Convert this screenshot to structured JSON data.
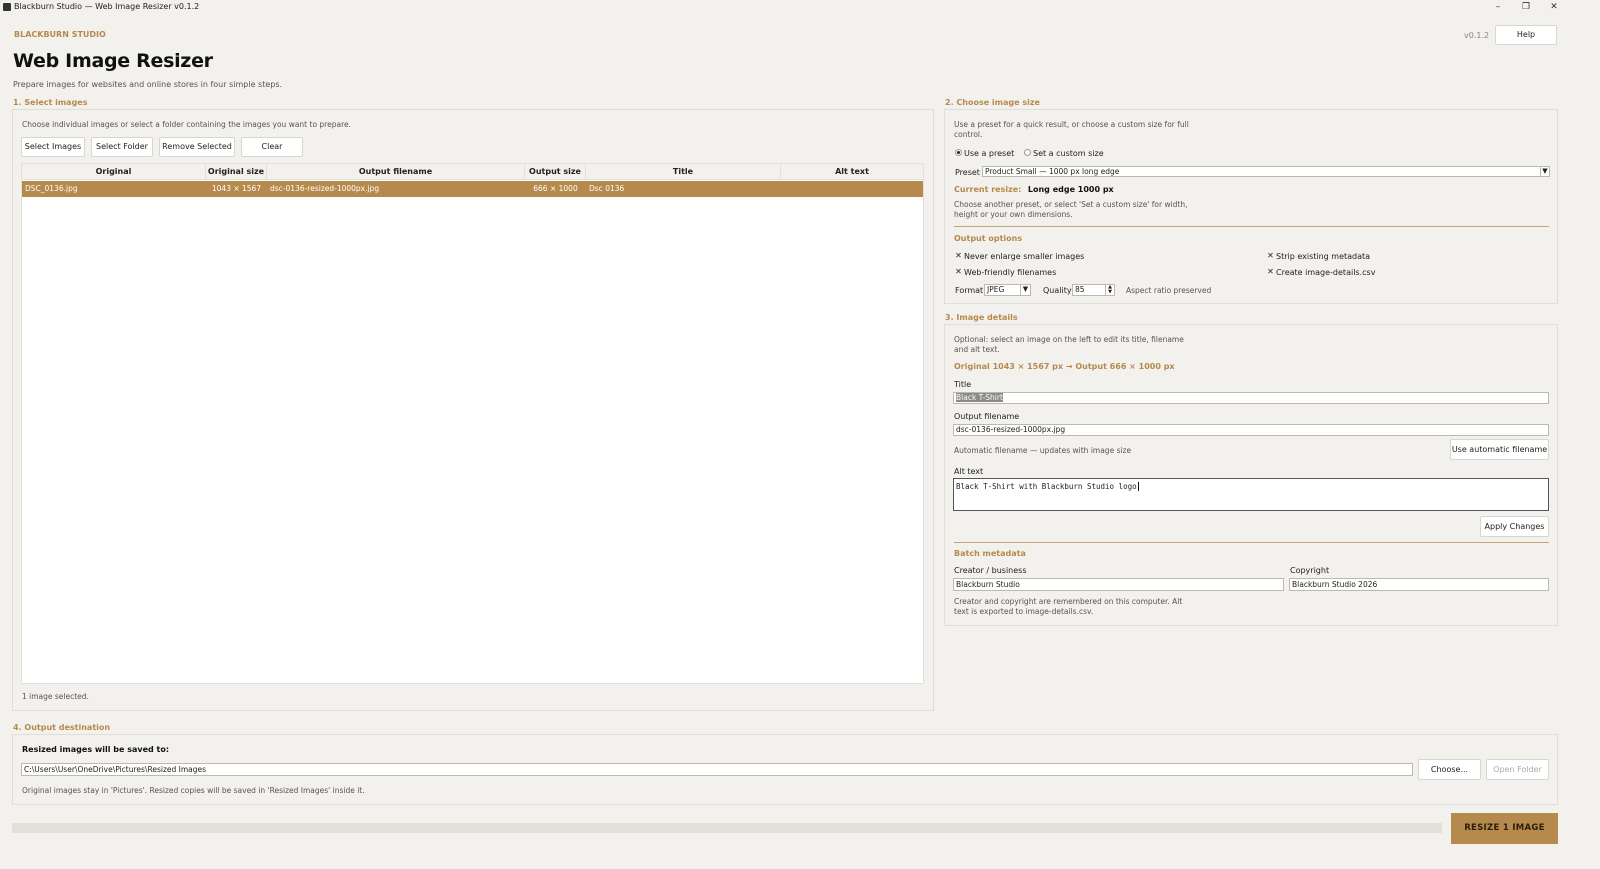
{
  "window": {
    "title": "Blackburn Studio — Web Image Resizer v0.1.2",
    "min_glyph": "–",
    "max_glyph": "❐",
    "close_glyph": "✕"
  },
  "header": {
    "brand": "BLACKBURN STUDIO",
    "version": "v0.1.2",
    "help_label": "Help",
    "title": "Web Image Resizer",
    "subtitle": "Prepare images for websites and online stores in four simple steps."
  },
  "select_images": {
    "section_label": "1. Select images",
    "hint": "Choose individual images or select a folder containing the images you want to prepare.",
    "buttons": {
      "select_images": "Select Images",
      "select_folder": "Select Folder",
      "remove_selected": "Remove Selected",
      "clear": "Clear"
    },
    "columns": [
      "Original",
      "Original size",
      "Output filename",
      "Output size",
      "Title",
      "Alt text"
    ],
    "rows": [
      {
        "original": "DSC_0136.jpg",
        "original_size": "1043 × 1567",
        "output_filename": "dsc-0136-resized-1000px.jpg",
        "output_size": "666 × 1000",
        "title": "Dsc 0136",
        "alt_text": ""
      }
    ],
    "status": "1 image selected."
  },
  "image_size": {
    "section_label": "2. Choose image size",
    "hint": "Use a preset for a quick result, or choose a custom size for full control.",
    "radio_preset": "Use a preset",
    "radio_custom": "Set a custom size",
    "preset_label": "Preset",
    "preset_value": "Product Small — 1000 px long edge",
    "current_resize_label": "Current resize:",
    "current_resize_value": "Long edge 1000 px",
    "current_hint": "Choose another preset, or select 'Set a custom size' for width, height or your own dimensions.",
    "output_options_label": "Output options",
    "options": {
      "never_enlarge": "Never enlarge smaller images",
      "strip_metadata": "Strip existing metadata",
      "web_friendly": "Web-friendly filenames",
      "create_csv": "Create image-details.csv"
    },
    "check_glyph": "✕",
    "format_label": "Format",
    "format_value": "JPEG",
    "quality_label": "Quality",
    "quality_value": "85",
    "aspect_note": "Aspect ratio preserved"
  },
  "image_details": {
    "section_label": "3. Image details",
    "hint": "Optional: select an image on the left to edit its title, filename and alt text.",
    "dims": "Original 1043 × 1567 px → Output 666 × 1000 px",
    "title_label": "Title",
    "title_value": "Black T-Shirt",
    "filename_label": "Output filename",
    "filename_value": "dsc-0136-resized-1000px.jpg",
    "auto_note": "Automatic filename — updates with image size",
    "auto_button": "Use automatic filename",
    "alt_label": "Alt text",
    "alt_value": "Black T-Shirt with Blackburn Studio logo",
    "apply_button": "Apply Changes",
    "batch_label": "Batch metadata",
    "creator_label": "Creator / business",
    "creator_value": "Blackburn Studio",
    "copyright_label": "Copyright",
    "copyright_value": "Blackburn Studio 2026",
    "batch_note": "Creator and copyright are remembered on this computer. Alt text is exported to image-details.csv."
  },
  "output": {
    "section_label": "4. Output destination",
    "heading": "Resized images will be saved to:",
    "path": "C:\\Users\\User\\OneDrive\\Pictures\\Resized Images",
    "choose_button": "Choose...",
    "open_button": "Open Folder",
    "note": "Original images stay in 'Pictures'. Resized copies will be saved in 'Resized Images' inside it."
  },
  "footer": {
    "progress": 0,
    "resize_button": "RESIZE 1 IMAGE"
  },
  "colors": {
    "accent": "#b58a4c",
    "background": "#f3f1ed"
  }
}
